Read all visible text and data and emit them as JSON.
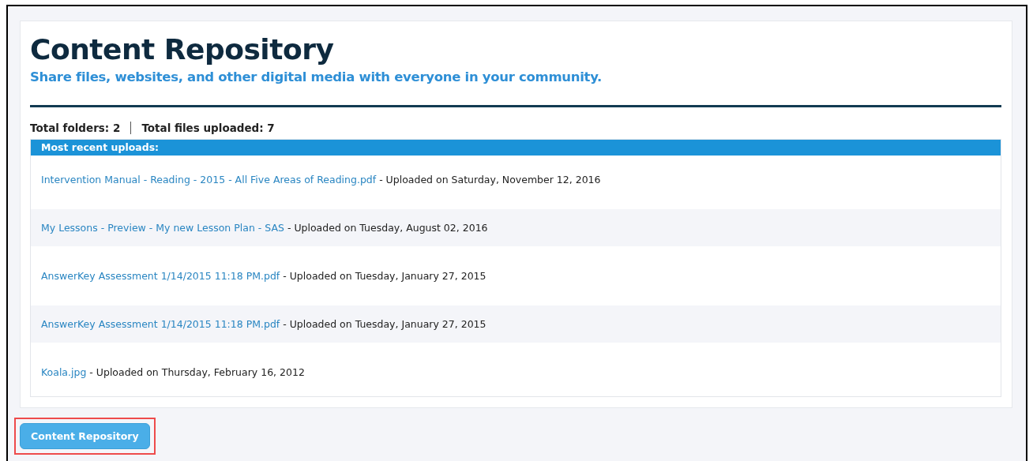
{
  "header": {
    "title": "Content Repository",
    "subtitle": "Share files, websites, and other digital media with everyone in your community."
  },
  "stats": {
    "folders": "Total folders: 2",
    "files": "Total files uploaded: 7"
  },
  "recent_uploads": {
    "heading": "Most recent uploads:",
    "items": [
      {
        "file": "Intervention Manual - Reading - 2015 - All Five Areas of Reading.pdf",
        "uploaded": " - Uploaded on Saturday, November 12, 2016"
      },
      {
        "file": "My Lessons - Preview - My new Lesson Plan - SAS",
        "uploaded": " - Uploaded on Tuesday, August 02, 2016"
      },
      {
        "file": "AnswerKey Assessment 1/14/2015 11:18 PM.pdf",
        "uploaded": " - Uploaded on Tuesday, January 27, 2015"
      },
      {
        "file": "AnswerKey Assessment 1/14/2015 11:18 PM.pdf",
        "uploaded": " - Uploaded on Tuesday, January 27, 2015"
      },
      {
        "file": "Koala.jpg",
        "uploaded": " - Uploaded on Thursday, February 16, 2012"
      }
    ]
  },
  "footer_button": {
    "label": "Content Repository",
    "highlighted": true
  }
}
